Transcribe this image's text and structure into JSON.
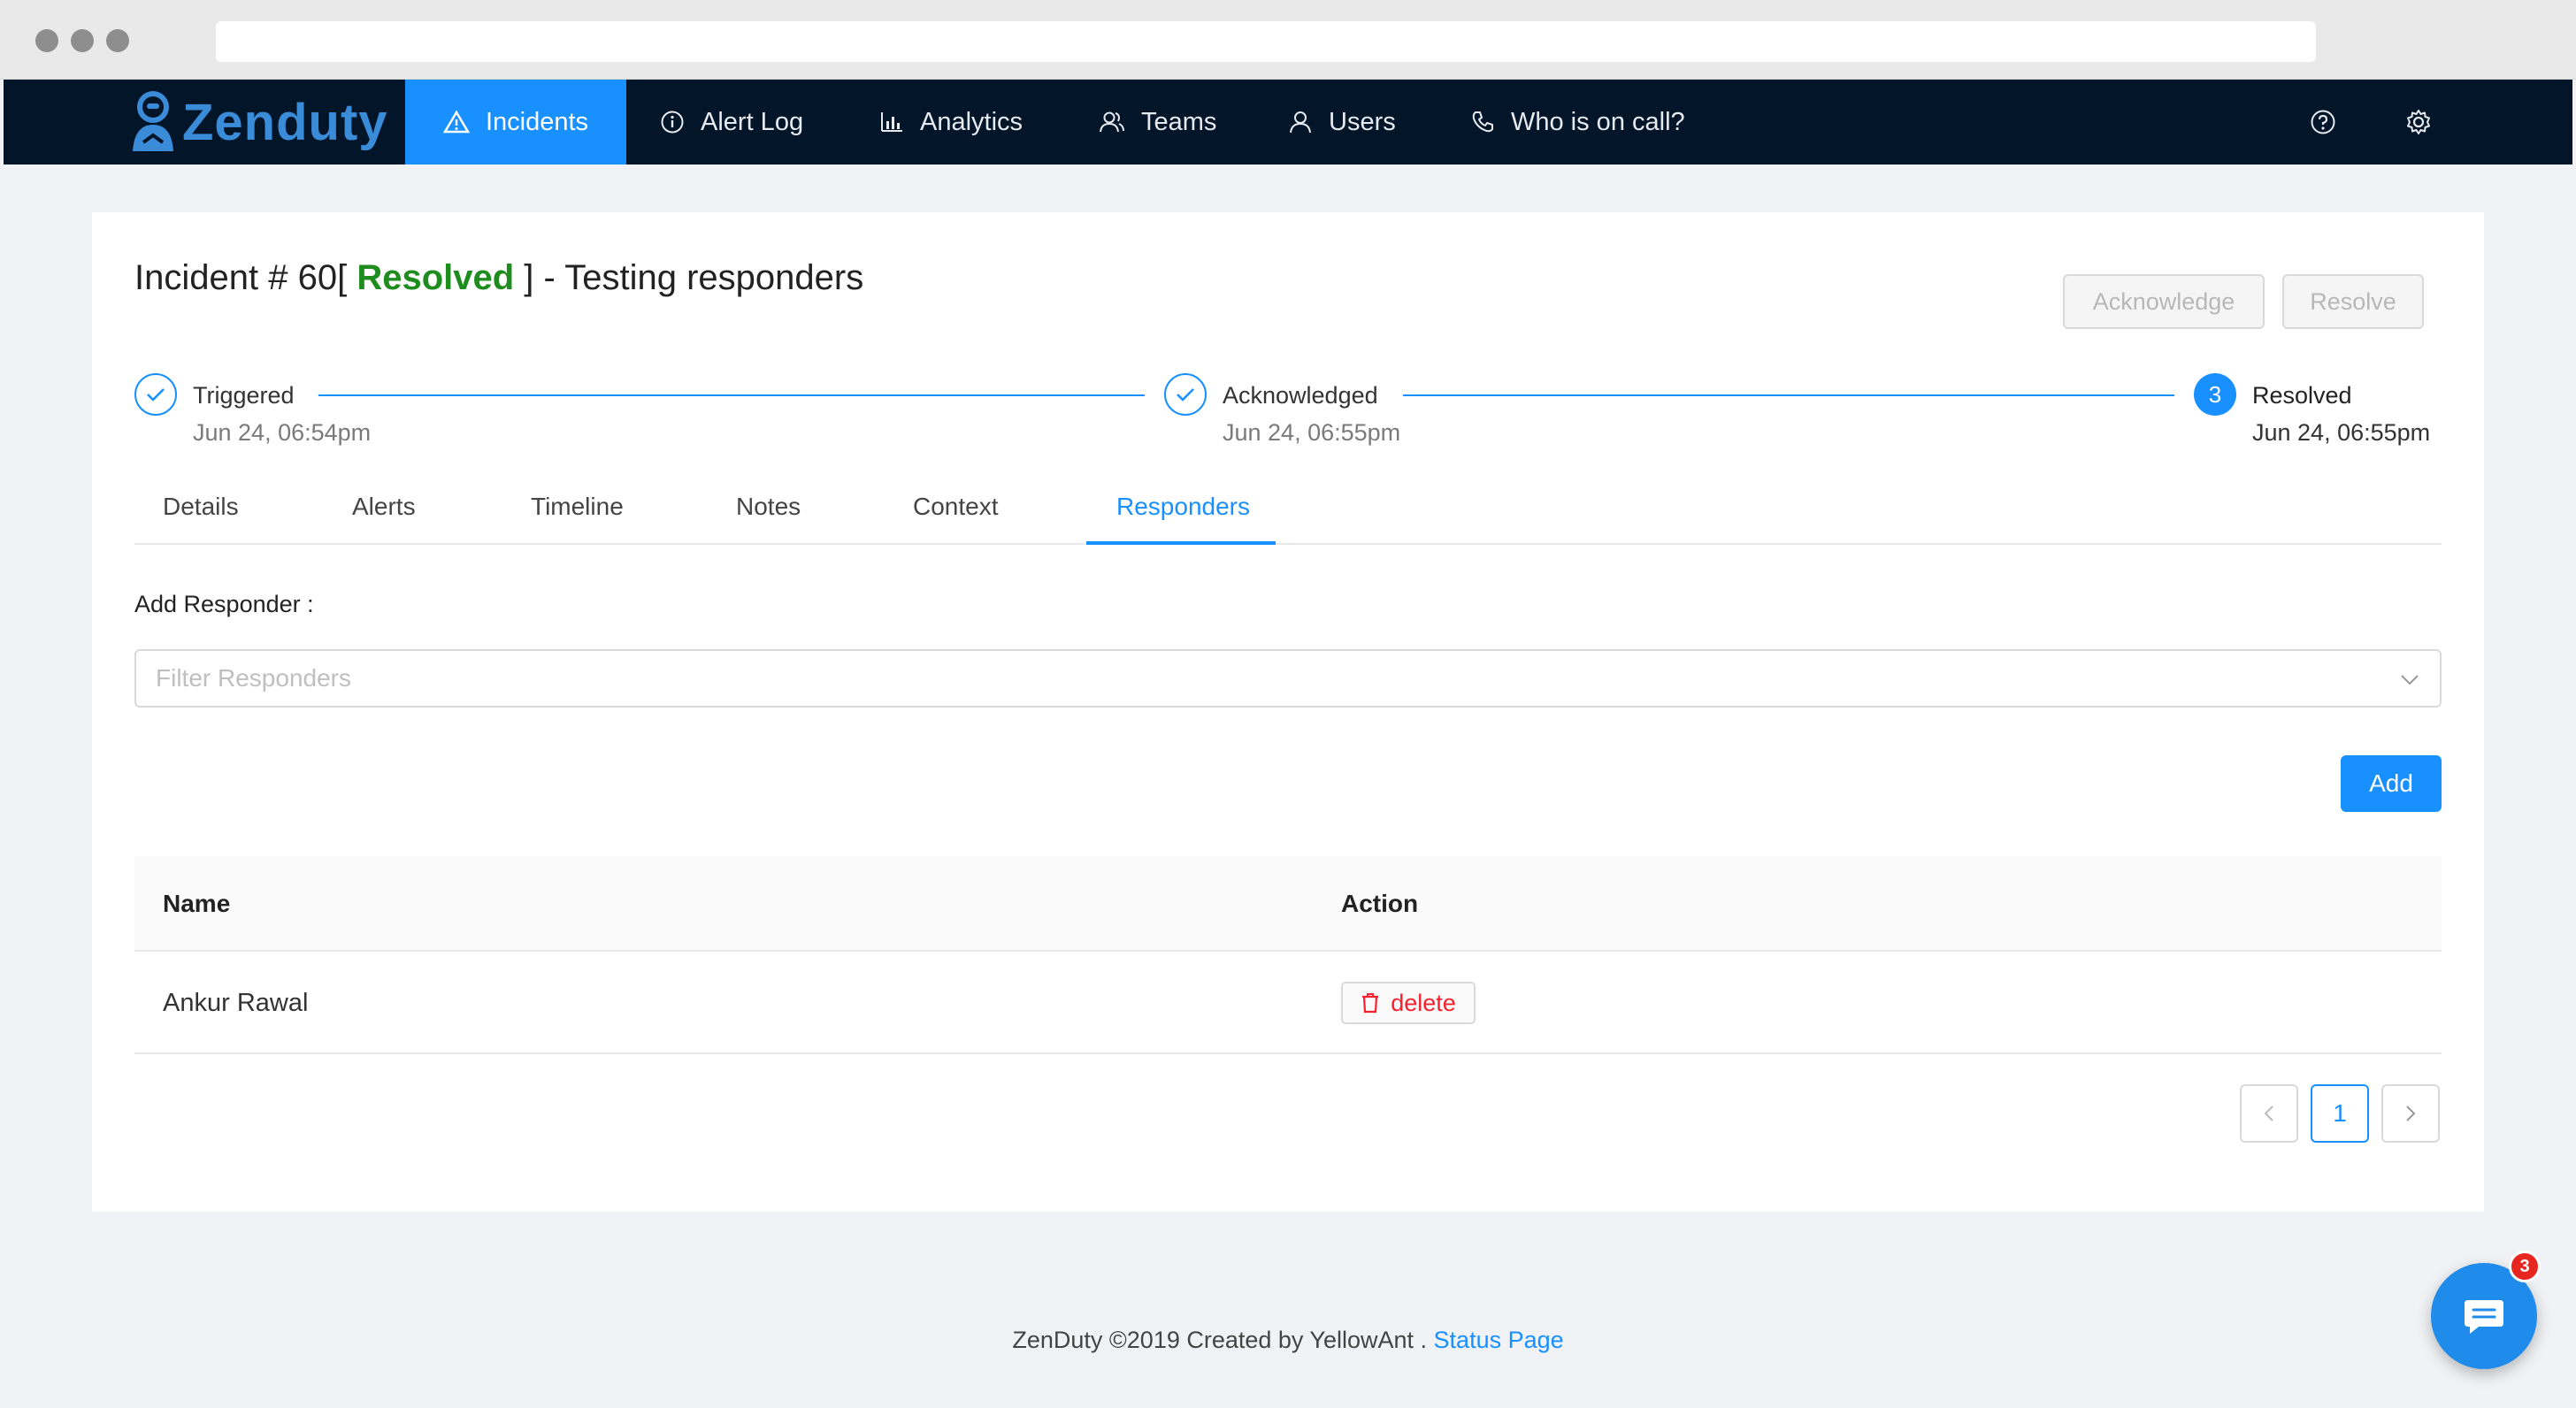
{
  "brand": {
    "name": "Zenduty",
    "color": "#1890ff"
  },
  "nav": {
    "items": [
      {
        "label": "Incidents",
        "icon": "warning-icon"
      },
      {
        "label": "Alert Log",
        "icon": "info-icon"
      },
      {
        "label": "Analytics",
        "icon": "bar-chart-icon"
      },
      {
        "label": "Teams",
        "icon": "team-icon"
      },
      {
        "label": "Users",
        "icon": "user-icon"
      },
      {
        "label": "Who is on call?",
        "icon": "phone-icon"
      }
    ],
    "help_icon": "question-icon",
    "settings_icon": "gear-icon"
  },
  "incident": {
    "title_prefix": "Incident # 60[",
    "status": "Resolved",
    "title_suffix": "] - Testing responders",
    "status_color": "#1e8c1e",
    "acknowledge_label": "Acknowledge",
    "resolve_label": "Resolve"
  },
  "steps": [
    {
      "title": "Triggered",
      "date": "Jun 24, 06:54pm",
      "state": "done"
    },
    {
      "title": "Acknowledged",
      "date": "Jun 24, 06:55pm",
      "state": "done"
    },
    {
      "number": "3",
      "title": "Resolved",
      "date": "Jun 24, 06:55pm",
      "state": "current"
    }
  ],
  "tabs": [
    {
      "label": "Details"
    },
    {
      "label": "Alerts"
    },
    {
      "label": "Timeline"
    },
    {
      "label": "Notes"
    },
    {
      "label": "Context"
    },
    {
      "label": "Responders",
      "active": true
    }
  ],
  "responders": {
    "add_label": "Add Responder :",
    "filter_placeholder": "Filter Responders",
    "add_button": "Add",
    "columns": [
      "Name",
      "Action"
    ],
    "rows": [
      {
        "name": "Ankur Rawal",
        "action": "delete"
      }
    ]
  },
  "pagination": {
    "prev": "<",
    "current": "1",
    "next": ">"
  },
  "footer": {
    "text": "ZenDuty ©2019 Created by YellowAnt .",
    "link": "Status Page"
  },
  "chat": {
    "badge_count": "3"
  }
}
